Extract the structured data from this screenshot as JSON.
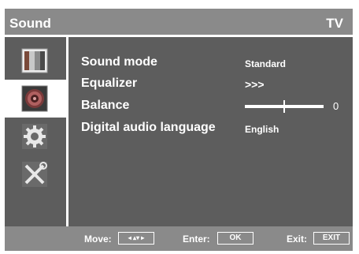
{
  "header": {
    "title": "Sound",
    "source": "TV"
  },
  "sidebar": {
    "items": [
      {
        "icon": "picture-icon",
        "active": false
      },
      {
        "icon": "speaker-icon",
        "active": true
      },
      {
        "icon": "gear-icon",
        "active": false
      },
      {
        "icon": "tools-icon",
        "active": false
      }
    ]
  },
  "menu": {
    "sound_mode": {
      "label": "Sound mode",
      "value": "Standard"
    },
    "equalizer": {
      "label": "Equalizer",
      "value": ">>>"
    },
    "balance": {
      "label": "Balance",
      "value": "0",
      "level": 0.5
    },
    "digital_audio_language": {
      "label": "Digital audio language",
      "value": "English"
    }
  },
  "footer": {
    "move_label": "Move:",
    "move_key": "◂ ▴▾ ▸",
    "enter_label": "Enter:",
    "enter_key": "OK",
    "exit_label": "Exit:",
    "exit_key": "EXIT"
  },
  "colors": {
    "panel": "#5d5d5d",
    "header": "#8a8a8a",
    "text": "#ffffff"
  }
}
